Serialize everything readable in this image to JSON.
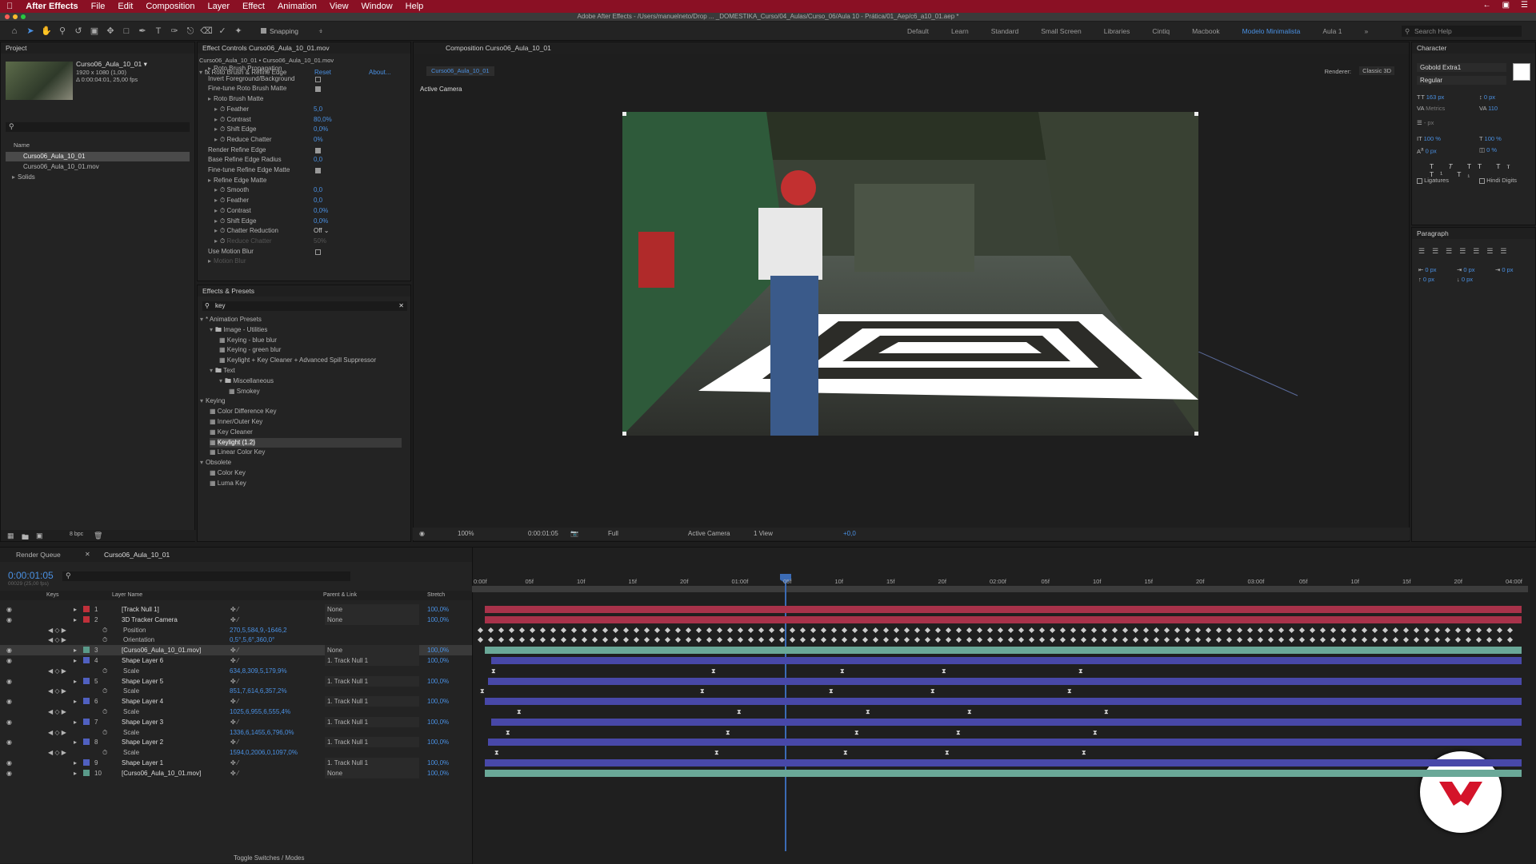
{
  "menu": {
    "app": "After Effects",
    "items": [
      "File",
      "Edit",
      "Composition",
      "Layer",
      "Effect",
      "Animation",
      "View",
      "Window",
      "Help"
    ]
  },
  "window_title": "Adobe After Effects - /Users/manuelneto/Drop ... _DOMESTIKA_Curso/04_Aulas/Curso_06/Aula 10 - Prática/01_Aep/c6_a10_01.aep *",
  "toolbar": {
    "snapping": "Snapping",
    "workspaces": [
      "Default",
      "Learn",
      "Standard",
      "Small Screen",
      "Libraries",
      "Cintiq",
      "Macbook",
      "Modelo Minimalista",
      "Aula 1"
    ],
    "active_workspace": "Modelo Minimalista",
    "search_help": "Search Help"
  },
  "project": {
    "tab": "Project",
    "item_name": "Curso06_Aula_10_01 ▾",
    "item_info": "1920 x 1080 (1,00)",
    "item_duration": "Δ 0:00:04:01, 25,00 fps",
    "col_name": "Name",
    "items": [
      "Curso06_Aula_10_01",
      "Curso06_Aula_10_01.mov",
      "Solids"
    ],
    "bpc": "8 bpc"
  },
  "effect_controls": {
    "tab": "Effect Controls Curso06_Aula_10_01.mov",
    "subtitle": "Curso06_Aula_10_01 • Curso06_Aula_10_01.mov",
    "effect_name": "Roto Brush & Refine Edge",
    "reset": "Reset",
    "about": "About...",
    "rows": [
      {
        "label": "Roto Brush Propagation",
        "value": "",
        "indent": 1,
        "type": "group"
      },
      {
        "label": "Invert Foreground/Background",
        "value": "",
        "indent": 1,
        "type": "check",
        "checked": false
      },
      {
        "label": "Fine-tune Roto Brush Matte",
        "value": "",
        "indent": 1,
        "type": "check",
        "checked": true
      },
      {
        "label": "Roto Brush Matte",
        "value": "",
        "indent": 1,
        "type": "group"
      },
      {
        "label": "Feather",
        "value": "5,0",
        "indent": 2,
        "type": "val"
      },
      {
        "label": "Contrast",
        "value": "80,0%",
        "indent": 2,
        "type": "val"
      },
      {
        "label": "Shift Edge",
        "value": "0,0%",
        "indent": 2,
        "type": "val"
      },
      {
        "label": "Reduce Chatter",
        "value": "0%",
        "indent": 2,
        "type": "val"
      },
      {
        "label": "Render Refine Edge",
        "value": "",
        "indent": 1,
        "type": "check",
        "checked": true
      },
      {
        "label": "Base Refine Edge Radius",
        "value": "0,0",
        "indent": 1,
        "type": "val"
      },
      {
        "label": "Fine-tune Refine Edge Matte",
        "value": "",
        "indent": 1,
        "type": "check",
        "checked": true
      },
      {
        "label": "Refine Edge Matte",
        "value": "",
        "indent": 1,
        "type": "group"
      },
      {
        "label": "Smooth",
        "value": "0,0",
        "indent": 2,
        "type": "val"
      },
      {
        "label": "Feather",
        "value": "0,0",
        "indent": 2,
        "type": "val"
      },
      {
        "label": "Contrast",
        "value": "0,0%",
        "indent": 2,
        "type": "val"
      },
      {
        "label": "Shift Edge",
        "value": "0,0%",
        "indent": 2,
        "type": "val"
      },
      {
        "label": "Chatter Reduction",
        "value": "Off",
        "indent": 2,
        "type": "select"
      },
      {
        "label": "Reduce Chatter",
        "value": "50%",
        "indent": 2,
        "type": "dim"
      },
      {
        "label": "Use Motion Blur",
        "value": "",
        "indent": 1,
        "type": "check",
        "checked": false
      },
      {
        "label": "Motion Blur",
        "value": "",
        "indent": 1,
        "type": "dimgroup"
      }
    ]
  },
  "effects_presets": {
    "tab": "Effects & Presets",
    "search": "key",
    "tree": [
      {
        "label": "* Animation Presets",
        "indent": 0,
        "kind": "open"
      },
      {
        "label": "Image - Utilities",
        "indent": 1,
        "kind": "folder"
      },
      {
        "label": "Keying - blue blur",
        "indent": 2,
        "kind": "preset"
      },
      {
        "label": "Keying - green blur",
        "indent": 2,
        "kind": "preset"
      },
      {
        "label": "Keylight + Key Cleaner + Advanced Spill Suppressor",
        "indent": 2,
        "kind": "preset"
      },
      {
        "label": "Text",
        "indent": 1,
        "kind": "folder"
      },
      {
        "label": "Miscellaneous",
        "indent": 2,
        "kind": "folder"
      },
      {
        "label": "Smokey",
        "indent": 3,
        "kind": "preset"
      },
      {
        "label": "Keying",
        "indent": 0,
        "kind": "open"
      },
      {
        "label": "Color Difference Key",
        "indent": 1,
        "kind": "effect"
      },
      {
        "label": "Inner/Outer Key",
        "indent": 1,
        "kind": "effect"
      },
      {
        "label": "Key Cleaner",
        "indent": 1,
        "kind": "effect"
      },
      {
        "label": "Keylight (1.2)",
        "indent": 1,
        "kind": "effect",
        "selected": true
      },
      {
        "label": "Linear Color Key",
        "indent": 1,
        "kind": "effect"
      },
      {
        "label": "Obsolete",
        "indent": 0,
        "kind": "open"
      },
      {
        "label": "Color Key",
        "indent": 1,
        "kind": "effect"
      },
      {
        "label": "Luma Key",
        "indent": 1,
        "kind": "effect"
      }
    ]
  },
  "composition": {
    "tab": "Composition Curso06_Aula_10_01",
    "subtab": "Curso06_Aula_10_01",
    "renderer_label": "Renderer:",
    "renderer": "Classic 3D",
    "camera_label": "Active Camera",
    "footer": {
      "zoom": "100%",
      "time": "0:00:01:05",
      "resolution": "Full",
      "view": "Active Camera",
      "views": "1 View",
      "exposure": "+0,0"
    }
  },
  "character": {
    "tab": "Character",
    "font": "Gobold Extra1",
    "style": "Regular",
    "size": "163 px",
    "leading": "0 px",
    "kerning": "Metrics",
    "tracking": "110",
    "stroke": "- px",
    "vscale": "100 %",
    "hscale": "100 %",
    "baseline": "0 px",
    "tsume": "0 %",
    "ligatures": "Ligatures",
    "hindi": "Hindi Digits"
  },
  "paragraph": {
    "tab": "Paragraph",
    "indent": "0 px"
  },
  "timeline": {
    "tabs": [
      "Render Queue",
      "Curso06_Aula_10_01"
    ],
    "timecode": "0:00:01:05",
    "timecode_sub": "00029 (25,00 fps)",
    "col_layer_name": "Layer Name",
    "col_parent": "Parent & Link",
    "col_stretch": "Stretch",
    "col_keys": "Keys",
    "ruler": [
      "0:00f",
      "05f",
      "10f",
      "15f",
      "20f",
      "01:00f",
      "05f",
      "10f",
      "15f",
      "20f",
      "02:00f",
      "05f",
      "10f",
      "15f",
      "20f",
      "03:00f",
      "05f",
      "10f",
      "15f",
      "20f",
      "04:00f"
    ],
    "toggle": "Toggle Switches / Modes",
    "rows": [
      {
        "num": "1",
        "name": "[Track Null 1]",
        "color": "#c0303a",
        "parent": "None",
        "stretch": "100,0%",
        "kind": "layer"
      },
      {
        "num": "2",
        "name": "3D Tracker Camera",
        "color": "#c0303a",
        "parent": "None",
        "stretch": "100,0%",
        "kind": "layer"
      },
      {
        "num": "",
        "name": "Position",
        "value": "270,5,584,9,-1646,2",
        "kind": "prop"
      },
      {
        "num": "",
        "name": "Orientation",
        "value": "0,5°,5,6°,360,0°",
        "kind": "prop"
      },
      {
        "num": "3",
        "name": "[Curso06_Aula_10_01.mov]",
        "color": "#5a9a8a",
        "parent": "None",
        "stretch": "100,0%",
        "kind": "layer",
        "selected": true
      },
      {
        "num": "4",
        "name": "Shape Layer 6",
        "color": "#5060c0",
        "parent": "1. Track Null 1",
        "stretch": "100,0%",
        "kind": "layer"
      },
      {
        "num": "",
        "name": "Scale",
        "value": "634,8,309,5,179,9%",
        "kind": "prop"
      },
      {
        "num": "5",
        "name": "Shape Layer 5",
        "color": "#5060c0",
        "parent": "1. Track Null 1",
        "stretch": "100,0%",
        "kind": "layer"
      },
      {
        "num": "",
        "name": "Scale",
        "value": "851,7,614,6,357,2%",
        "kind": "prop"
      },
      {
        "num": "6",
        "name": "Shape Layer 4",
        "color": "#5060c0",
        "parent": "1. Track Null 1",
        "stretch": "100,0%",
        "kind": "layer"
      },
      {
        "num": "",
        "name": "Scale",
        "value": "1025,6,955,6,555,4%",
        "kind": "prop"
      },
      {
        "num": "7",
        "name": "Shape Layer 3",
        "color": "#5060c0",
        "parent": "1. Track Null 1",
        "stretch": "100,0%",
        "kind": "layer"
      },
      {
        "num": "",
        "name": "Scale",
        "value": "1336,6,1455,6,796,0%",
        "kind": "prop"
      },
      {
        "num": "8",
        "name": "Shape Layer 2",
        "color": "#5060c0",
        "parent": "1. Track Null 1",
        "stretch": "100,0%",
        "kind": "layer"
      },
      {
        "num": "",
        "name": "Scale",
        "value": "1594,0,2006,0,1097,0%",
        "kind": "prop"
      },
      {
        "num": "9",
        "name": "Shape Layer 1",
        "color": "#5060c0",
        "parent": "1. Track Null 1",
        "stretch": "100,0%",
        "kind": "layer"
      },
      {
        "num": "10",
        "name": "[Curso06_Aula_10_01.mov]",
        "color": "#5a9a8a",
        "parent": "None",
        "stretch": "100,0%",
        "kind": "layer"
      }
    ]
  },
  "colors": {
    "accent": "#4a90e2",
    "menubar": "#8a1024",
    "camera_bar": "#a8324a",
    "footage_bar": "#6aa898",
    "shape_bar": "#4848a8"
  }
}
